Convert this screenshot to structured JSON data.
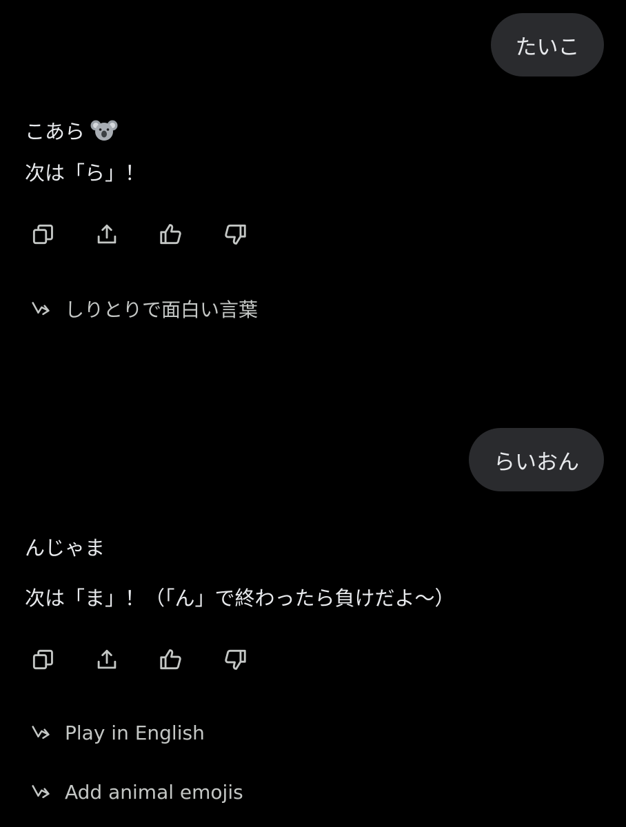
{
  "conversation": {
    "turn1": {
      "user_message": "たいこ",
      "reply_word": "こあら",
      "reply_word_emoji": "koala-icon",
      "reply_next": "次は「ら」！",
      "suggestions": [
        {
          "label": "しりとりで面白い言葉"
        }
      ]
    },
    "turn2": {
      "user_message": "らいおん",
      "reply_word": "んじゃま",
      "reply_next": "次は「ま」！（「ん」で終わったら負けだよ〜）",
      "suggestions": [
        {
          "label": "Play in English"
        },
        {
          "label": "Add animal emojis"
        }
      ]
    }
  },
  "action_icons": [
    "copy-icon",
    "share-icon",
    "thumbs-up-icon",
    "thumbs-down-icon"
  ],
  "colors": {
    "background": "#000000",
    "bubble": "#2a2b2e",
    "text": "#e8eaed",
    "icon": "#c4c7c5"
  }
}
